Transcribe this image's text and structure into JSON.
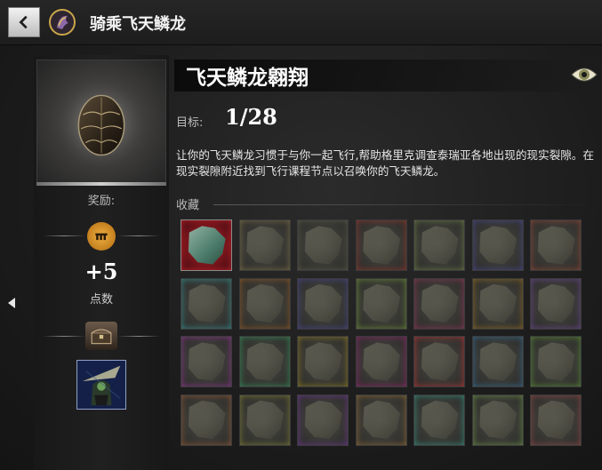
{
  "header": {
    "title": "骑乘飞天鳞龙"
  },
  "achievement": {
    "title": "飞天鳞龙翱翔",
    "goal_label": "目标:",
    "goal_value": "1/28",
    "description": "让你的飞天鳞龙习惯于与你一起飞行,帮助格里克调查泰瑞亚各地出现的现实裂隙。在现实裂隙附近找到飞行课程节点以召唤你的飞天鳞龙。",
    "collection_label": "收藏"
  },
  "rewards": {
    "label": "奖励:",
    "points_value": "+5",
    "points_label": "点数"
  },
  "collection_tiles": [
    {
      "color": "#c0242a",
      "unlocked": true
    },
    {
      "color": "#7a6d4a",
      "unlocked": false
    },
    {
      "color": "#5a5a4a",
      "unlocked": false
    },
    {
      "color": "#8a3a30",
      "unlocked": false
    },
    {
      "color": "#6a7a4a",
      "unlocked": false
    },
    {
      "color": "#4a4a8a",
      "unlocked": false
    },
    {
      "color": "#8a4a3a",
      "unlocked": false
    },
    {
      "color": "#3a8a8a",
      "unlocked": false
    },
    {
      "color": "#8a5a2a",
      "unlocked": false
    },
    {
      "color": "#4a4a8a",
      "unlocked": false
    },
    {
      "color": "#6a8a3a",
      "unlocked": false
    },
    {
      "color": "#8a3a5a",
      "unlocked": false
    },
    {
      "color": "#8a6a2a",
      "unlocked": false
    },
    {
      "color": "#6a4a8a",
      "unlocked": false
    },
    {
      "color": "#8a3a8a",
      "unlocked": false
    },
    {
      "color": "#3a8a5a",
      "unlocked": false
    },
    {
      "color": "#8a7a2a",
      "unlocked": false
    },
    {
      "color": "#8a2a6a",
      "unlocked": false
    },
    {
      "color": "#aa3a3a",
      "unlocked": false
    },
    {
      "color": "#3a6a8a",
      "unlocked": false
    },
    {
      "color": "#5a8a3a",
      "unlocked": false
    },
    {
      "color": "#8a5a3a",
      "unlocked": false
    },
    {
      "color": "#7a7a3a",
      "unlocked": false
    },
    {
      "color": "#6a3a8a",
      "unlocked": false
    },
    {
      "color": "#8a6a3a",
      "unlocked": false
    },
    {
      "color": "#3a8a7a",
      "unlocked": false
    },
    {
      "color": "#6a8a4a",
      "unlocked": false
    },
    {
      "color": "#8a4a4a",
      "unlocked": false
    }
  ],
  "icons": {
    "back": "chevron-left-icon",
    "header": "griffon-emblem-icon",
    "eye": "eye-icon",
    "token": "mastery-token-icon",
    "chest": "chest-icon",
    "side_arrow": "caret-left-icon"
  }
}
